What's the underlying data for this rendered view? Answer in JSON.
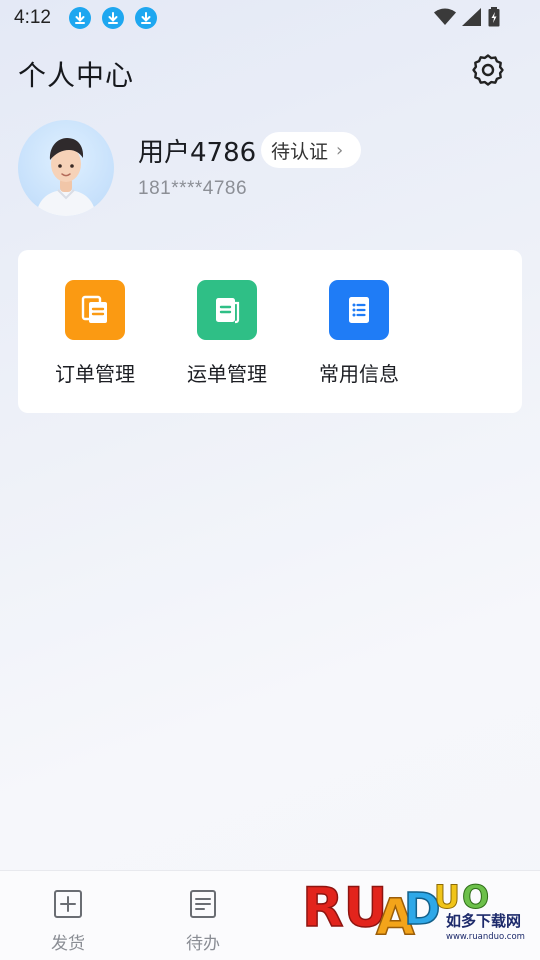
{
  "status_bar": {
    "time": "4:12",
    "download_icon_count": 3,
    "icons": [
      "wifi-icon",
      "signal-icon",
      "battery-icon"
    ],
    "download_color": "#1ea7f0"
  },
  "header": {
    "title": "个人中心",
    "settings_icon": "gear-icon"
  },
  "profile": {
    "username": "用户4786",
    "verify_label": "待认证",
    "verify_chevron": "›",
    "phone": "181****4786"
  },
  "menu": {
    "items": [
      {
        "label": "订单管理",
        "icon": "order-document-icon",
        "color": "#fb9a12"
      },
      {
        "label": "运单管理",
        "icon": "waybill-icon",
        "color": "#2fbf86"
      },
      {
        "label": "常用信息",
        "icon": "list-info-icon",
        "color": "#1f7cf6"
      }
    ]
  },
  "tabs": [
    {
      "label": "发货",
      "icon": "plus-square-icon"
    },
    {
      "label": "待办",
      "icon": "todo-list-icon"
    }
  ],
  "watermark": {
    "brand": "RUANDUO",
    "tagline": "如多下载网",
    "url": "www.ruanduo.com"
  }
}
